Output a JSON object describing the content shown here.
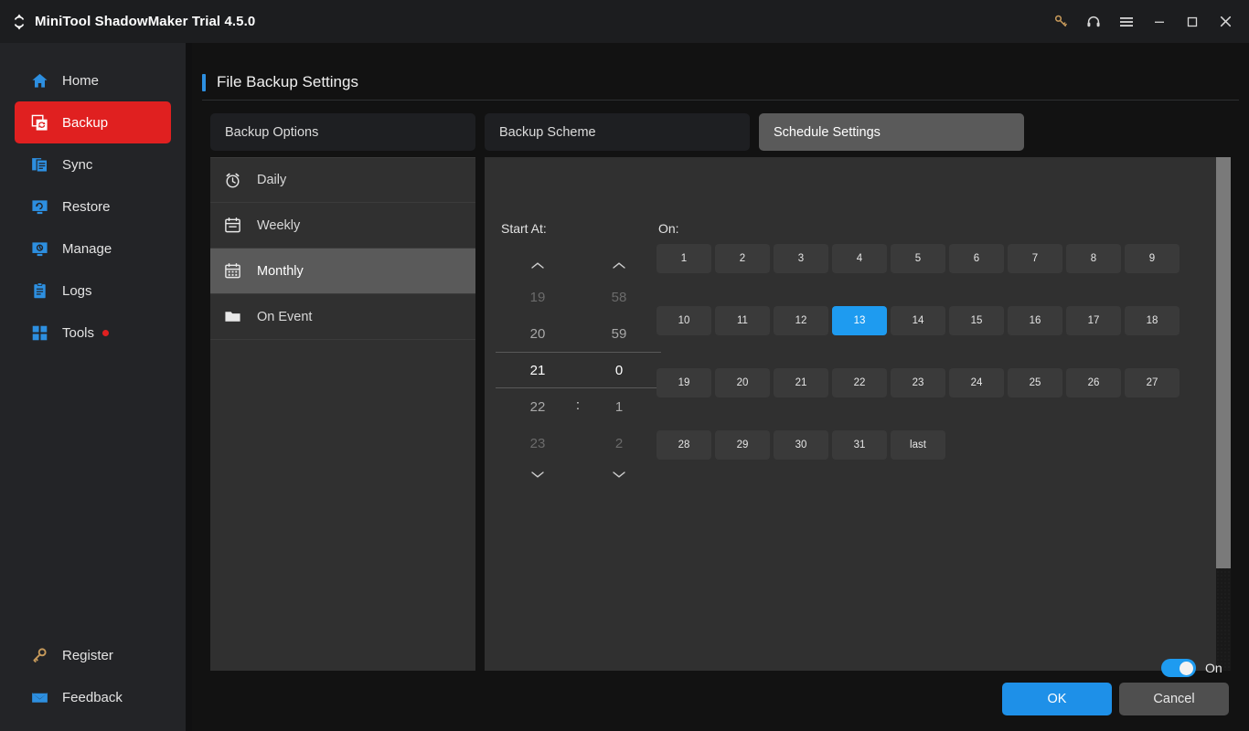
{
  "window": {
    "title": "MiniTool ShadowMaker Trial 4.5.0",
    "logo_icon": "refresh-arrows-logo",
    "controls": [
      {
        "name": "register-key-icon",
        "glyph": "key"
      },
      {
        "name": "support-headset-icon",
        "glyph": "headset"
      },
      {
        "name": "menu-hamburger-icon",
        "glyph": "hamburger"
      },
      {
        "name": "minimize-icon",
        "glyph": "minimize"
      },
      {
        "name": "maximize-icon",
        "glyph": "maximize"
      },
      {
        "name": "close-icon",
        "glyph": "close"
      }
    ]
  },
  "sidebar": {
    "items": [
      {
        "label": "Home",
        "icon": "home-icon",
        "active": false
      },
      {
        "label": "Backup",
        "icon": "backup-icon",
        "active": true
      },
      {
        "label": "Sync",
        "icon": "sync-icon",
        "active": false
      },
      {
        "label": "Restore",
        "icon": "restore-icon",
        "active": false
      },
      {
        "label": "Manage",
        "icon": "manage-icon",
        "active": false
      },
      {
        "label": "Logs",
        "icon": "logs-icon",
        "active": false
      },
      {
        "label": "Tools",
        "icon": "tools-icon",
        "active": false,
        "badge_dot": true
      }
    ],
    "bottom_items": [
      {
        "label": "Register",
        "icon": "key-icon"
      },
      {
        "label": "Feedback",
        "icon": "envelope-icon"
      }
    ]
  },
  "main": {
    "page_title": "File Backup Settings",
    "tabs": [
      {
        "label": "Backup Options",
        "active": false
      },
      {
        "label": "Backup Scheme",
        "active": false
      },
      {
        "label": "Schedule Settings",
        "active": true
      }
    ],
    "schedule_types": [
      {
        "label": "Daily",
        "icon": "alarm-clock-icon",
        "active": false
      },
      {
        "label": "Weekly",
        "icon": "calendar-icon",
        "active": false
      },
      {
        "label": "Monthly",
        "icon": "calendar-month-icon",
        "active": true
      },
      {
        "label": "On Event",
        "icon": "folder-icon",
        "active": false
      }
    ],
    "start_at": {
      "label": "Start At:",
      "separator": ":",
      "hours": [
        {
          "value": "19",
          "state": "far"
        },
        {
          "value": "20",
          "state": "near"
        },
        {
          "value": "21",
          "state": "sel"
        },
        {
          "value": "22",
          "state": "near"
        },
        {
          "value": "23",
          "state": "far"
        }
      ],
      "minutes": [
        {
          "value": "58",
          "state": "far"
        },
        {
          "value": "59",
          "state": "near"
        },
        {
          "value": "0",
          "state": "sel"
        },
        {
          "value": "1",
          "state": "near"
        },
        {
          "value": "2",
          "state": "far"
        }
      ],
      "selected_hour": "21",
      "selected_minute": "0"
    },
    "on_section": {
      "label": "On:",
      "selected_day": "13",
      "rows": [
        [
          "1",
          "2",
          "3",
          "4",
          "5",
          "6",
          "7",
          "8",
          "9"
        ],
        [
          "10",
          "11",
          "12",
          "13",
          "14",
          "15",
          "16",
          "17",
          "18"
        ],
        [
          "19",
          "20",
          "21",
          "22",
          "23",
          "24",
          "25",
          "26",
          "27"
        ],
        [
          "28",
          "29",
          "30",
          "31",
          "last"
        ]
      ]
    },
    "footer": {
      "toggle_state": "On",
      "toggle_on": true,
      "ok_label": "OK",
      "cancel_label": "Cancel"
    }
  },
  "colors": {
    "accent_blue": "#1e9bf0",
    "active_red": "#e02020",
    "panel_bg": "#303030",
    "page_bg": "#121212",
    "sidebar_bg": "#232427",
    "key_gold": "#c79a5b"
  }
}
